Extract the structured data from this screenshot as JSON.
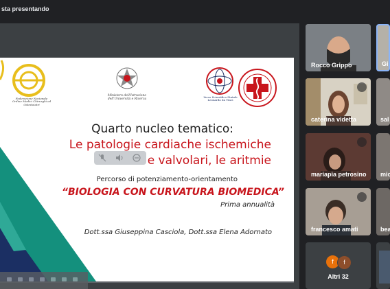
{
  "header": {
    "presenting_text": "sta presentando"
  },
  "slide": {
    "logo_left_text": "Federazione Nazionale\nOrdine Medici Chirurghi ed Odontoiatri",
    "logo_center_text": "Ministero dell'Istruzione\ndell'Università e Ricerca",
    "logo_right1_text": "Liceo Scientifico Statale\nLeonardo da Vinci",
    "title_line1": "Quarto nucleo tematico:",
    "title_line2": "Le patologie cardiache ischemiche",
    "title_line3": "e valvolari, le aritmie",
    "subtitle": "Percorso di potenziamento-orientamento",
    "course_title": "“BIOLOGIA CON CURVATURA BIOMEDICA”",
    "year": "Prima annualità",
    "authors": "Dott.ssa Giuseppina Casciola, Dott.ssa Elena Adornato"
  },
  "participants": [
    {
      "name": "Rocco Grippo"
    },
    {
      "name": "Giu"
    },
    {
      "name": "caterina videtta"
    },
    {
      "name": "sal"
    },
    {
      "name": "mariapia petrosino"
    },
    {
      "name": "mic"
    },
    {
      "name": "francesco amati"
    },
    {
      "name": "bea"
    }
  ],
  "others": {
    "label": "Altri 32",
    "avatar_letter_1": "f",
    "avatar_letter_2": "f"
  },
  "colors": {
    "meet_bg": "#202124",
    "tile_bg": "#3c4043",
    "slide_red": "#c8151c",
    "teal": "#14907d",
    "navy": "#1b2f63",
    "yellow": "#e8be1c",
    "avatar_orange": "#e8710a",
    "avatar_brown": "#8d4e2b"
  }
}
